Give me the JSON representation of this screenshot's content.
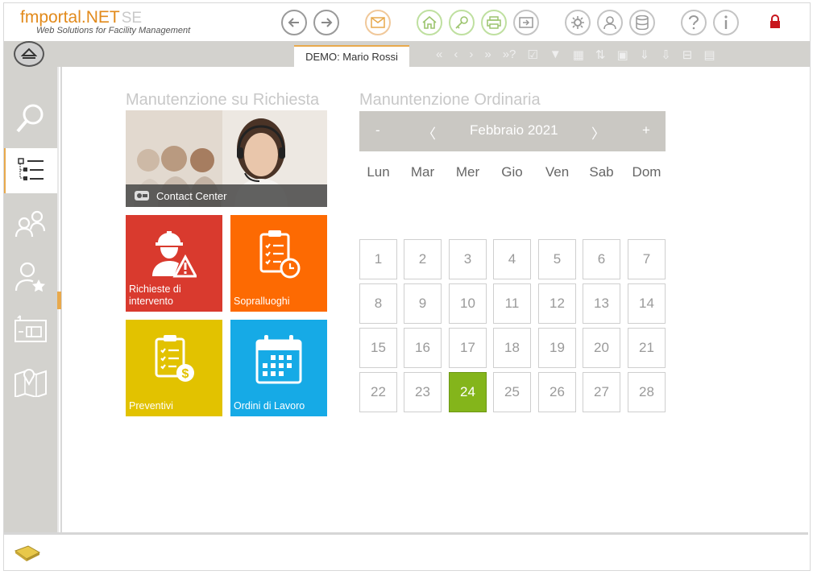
{
  "header": {
    "logo_main": "fmportal.NET",
    "logo_ghost": "SE",
    "tagline": "Web Solutions for Facility Management"
  },
  "toolbar": {
    "icons": [
      "back-icon",
      "forward-icon",
      "mail-icon",
      "home-icon",
      "key-icon",
      "print-icon",
      "export-icon",
      "settings-icon",
      "user-icon",
      "database-icon",
      "help-icon",
      "info-icon",
      "lock-icon"
    ]
  },
  "tabs": {
    "active_label": "DEMO: Mario Rossi"
  },
  "sections": {
    "left_title": "Manutenzione su Richiesta",
    "right_title": "Manuntenzione Ordinaria"
  },
  "contact_center": {
    "label": "Contact Center"
  },
  "tiles": [
    {
      "label": "Richieste di intervento",
      "color": "#d93a2e"
    },
    {
      "label": "Sopralluoghi",
      "color": "#fd6a02"
    },
    {
      "label": "Preventivi",
      "color": "#e2c200"
    },
    {
      "label": "Ordini di Lavoro",
      "color": "#16aae6"
    }
  ],
  "calendar": {
    "month_label": "Febbraio 2021",
    "minus": "-",
    "plus": "+",
    "prev": "〈",
    "next": "〉",
    "weekdays": [
      "Lun",
      "Mar",
      "Mer",
      "Gio",
      "Ven",
      "Sab",
      "Dom"
    ],
    "days": [
      "1",
      "2",
      "3",
      "4",
      "5",
      "6",
      "7",
      "8",
      "9",
      "10",
      "11",
      "12",
      "13",
      "14",
      "15",
      "16",
      "17",
      "18",
      "19",
      "20",
      "21",
      "22",
      "23",
      "24",
      "25",
      "26",
      "27",
      "28"
    ],
    "today": "24",
    "today_color": "#84b51b"
  }
}
